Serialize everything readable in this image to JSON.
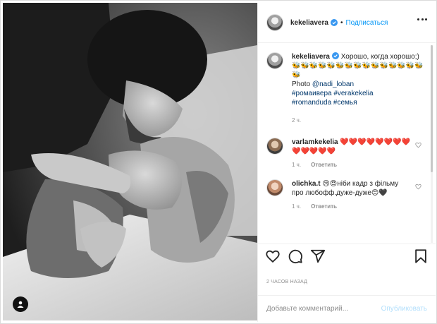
{
  "header": {
    "username": "kekeliavera",
    "follow_label": "Подписаться",
    "separator": "•"
  },
  "caption": {
    "username": "kekeliavera",
    "text": "Хорошо, когда хорошо;)",
    "emoji": "🐝🐝🐝🐝🐝🐝🐝🐝🐝🐝🐝🐝🐝🐝🐝🐝",
    "photo_prefix": "Photo ",
    "photo_mention": "@nadi_loban",
    "hashtags_1": "#ромаивера #verakekelia",
    "hashtags_2": "#romanduda #семья",
    "time": "2 ч."
  },
  "comments": [
    {
      "username": "varlamkekelia",
      "text": "❤️❤️❤️❤️❤️❤️❤️❤️❤️❤️❤️❤️❤️",
      "time": "1 ч.",
      "reply_label": "Ответить"
    },
    {
      "username": "olichka.t",
      "text": "😢😍ніби кадр з фільму про любофф.дуже-дуже😍🖤",
      "time": "1 ч.",
      "reply_label": "Ответить"
    }
  ],
  "date_label": "2 ЧАСОВ НАЗАД",
  "add_comment": {
    "placeholder": "Добавьте комментарий...",
    "publish_label": "Опубликовать"
  },
  "colors": {
    "accent": "#0095f6",
    "link": "#00376b",
    "muted": "#8e8e8e",
    "heart": "#ed4956",
    "publish_disabled": "#b2dffc"
  },
  "icons": [
    "verified-badge-icon",
    "more-icon",
    "heart-icon",
    "comment-icon",
    "share-icon",
    "bookmark-icon",
    "user-tag-icon",
    "small-heart-icon"
  ]
}
